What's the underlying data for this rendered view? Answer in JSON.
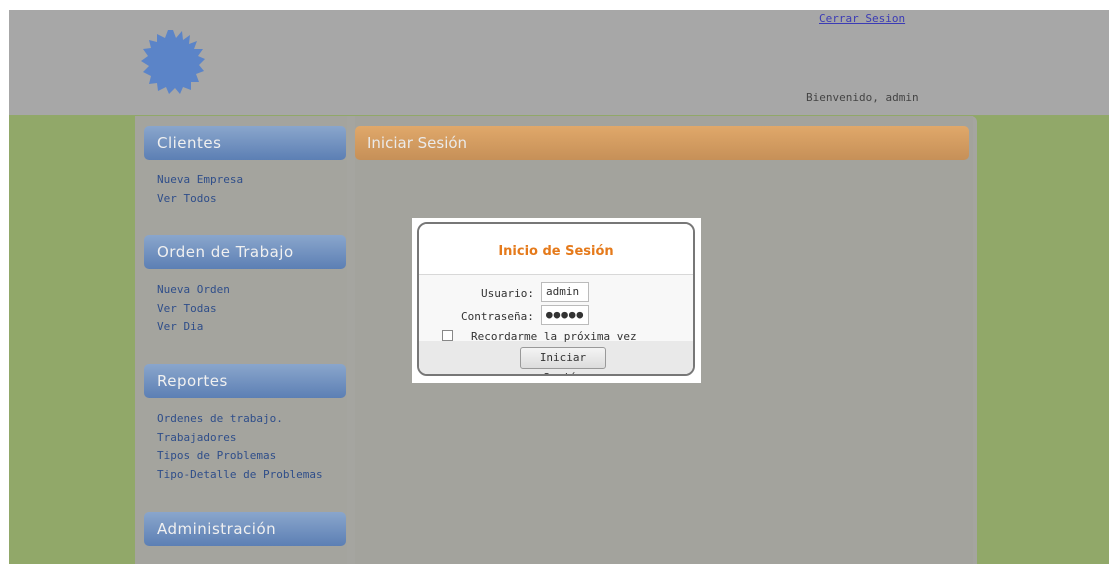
{
  "header": {
    "logout_link": "Cerrar Sesion",
    "welcome_text": "Bienvenido, admin"
  },
  "sidebar": {
    "sections": [
      {
        "title": "Clientes",
        "items": [
          "Nueva Empresa",
          "Ver Todos"
        ]
      },
      {
        "title": "Orden de Trabajo",
        "items": [
          "Nueva Orden",
          "Ver Todas",
          "Ver Dia"
        ]
      },
      {
        "title": "Reportes",
        "items": [
          "Ordenes de trabajo.",
          "Trabajadores",
          "Tipos de Problemas",
          "Tipo-Detalle de Problemas"
        ]
      },
      {
        "title": "Administración",
        "items": []
      }
    ]
  },
  "main": {
    "title": "Iniciar Sesión"
  },
  "login_dialog": {
    "title": "Inicio de Sesión",
    "username_label": "Usuario:",
    "username_value": "admin",
    "password_label": "Contraseña:",
    "password_value": "●●●●●",
    "remember_label": "Recordarme la próxima vez",
    "remember_checked": false,
    "submit_label": "Iniciar Sesión"
  },
  "colors": {
    "page_green": "#91a869",
    "sidebar_header_blue": "#5c7fb4",
    "main_header_orange": "#c69058",
    "dialog_title_orange": "#e57a1b"
  }
}
